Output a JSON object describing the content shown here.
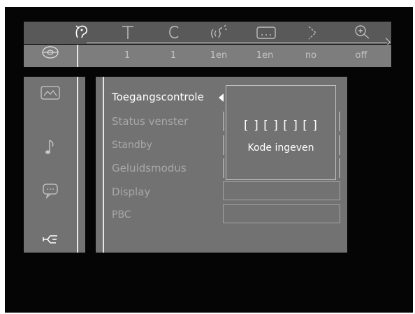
{
  "topbar": {
    "icons": [
      {
        "name": "disc-menu-icon",
        "glyph": "☊"
      },
      {
        "name": "title-icon",
        "glyph": "T"
      },
      {
        "name": "chapter-icon",
        "glyph": "C"
      },
      {
        "name": "audio-icon",
        "glyph": "((ʗ"
      },
      {
        "name": "subtitle-icon",
        "glyph": "⌷"
      },
      {
        "name": "angle-icon",
        "glyph": "⋗"
      },
      {
        "name": "zoom-icon",
        "glyph": "⊕"
      }
    ]
  },
  "valuebar": {
    "disc_icon": "sacd-disc-icon",
    "values": [
      "1",
      "1",
      "1en",
      "1en",
      "no",
      "off"
    ]
  },
  "categories": [
    {
      "name": "picture-icon",
      "glyph": "⛰"
    },
    {
      "name": "sound-icon",
      "glyph": "♪"
    },
    {
      "name": "language-icon",
      "glyph": "☐"
    },
    {
      "name": "features-icon",
      "glyph": "☞"
    }
  ],
  "menu": {
    "items": [
      {
        "label": "Toegangscontrole",
        "active": true
      },
      {
        "label": "Status venster",
        "active": false
      },
      {
        "label": "Standby",
        "active": false
      },
      {
        "label": "Geluidsmodus",
        "active": false
      },
      {
        "label": "Display",
        "active": false
      },
      {
        "label": "PBC",
        "active": false
      }
    ]
  },
  "popup": {
    "code": "[ ] [ ] [ ] [ ]",
    "message": "Kode ingeven"
  }
}
